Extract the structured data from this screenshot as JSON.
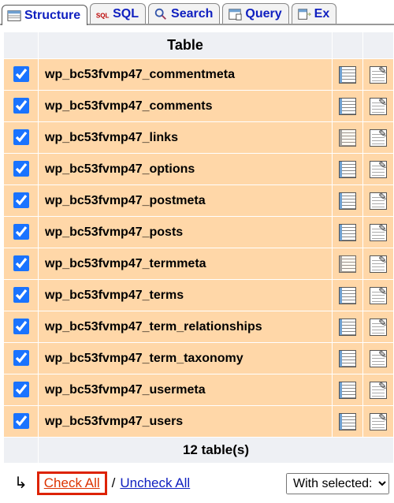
{
  "tabs": [
    {
      "label": "Structure",
      "active": true
    },
    {
      "label": "SQL",
      "active": false
    },
    {
      "label": "Search",
      "active": false
    },
    {
      "label": "Query",
      "active": false
    },
    {
      "label": "Ex",
      "active": false
    }
  ],
  "table_header": "Table",
  "rows": [
    {
      "checked": true,
      "name": "wp_bc53fvmp47_commentmeta",
      "browse_variant": "solid"
    },
    {
      "checked": true,
      "name": "wp_bc53fvmp47_comments",
      "browse_variant": "solid"
    },
    {
      "checked": true,
      "name": "wp_bc53fvmp47_links",
      "browse_variant": "faded"
    },
    {
      "checked": true,
      "name": "wp_bc53fvmp47_options",
      "browse_variant": "solid"
    },
    {
      "checked": true,
      "name": "wp_bc53fvmp47_postmeta",
      "browse_variant": "solid"
    },
    {
      "checked": true,
      "name": "wp_bc53fvmp47_posts",
      "browse_variant": "solid"
    },
    {
      "checked": true,
      "name": "wp_bc53fvmp47_termmeta",
      "browse_variant": "faded"
    },
    {
      "checked": true,
      "name": "wp_bc53fvmp47_terms",
      "browse_variant": "solid"
    },
    {
      "checked": true,
      "name": "wp_bc53fvmp47_term_relationships",
      "browse_variant": "solid"
    },
    {
      "checked": true,
      "name": "wp_bc53fvmp47_term_taxonomy",
      "browse_variant": "solid"
    },
    {
      "checked": true,
      "name": "wp_bc53fvmp47_usermeta",
      "browse_variant": "solid"
    },
    {
      "checked": true,
      "name": "wp_bc53fvmp47_users",
      "browse_variant": "solid"
    }
  ],
  "footer_count": "12 table(s)",
  "check_all": "Check All",
  "uncheck_all": "Uncheck All",
  "separator": " / ",
  "with_selected": "With selected:"
}
